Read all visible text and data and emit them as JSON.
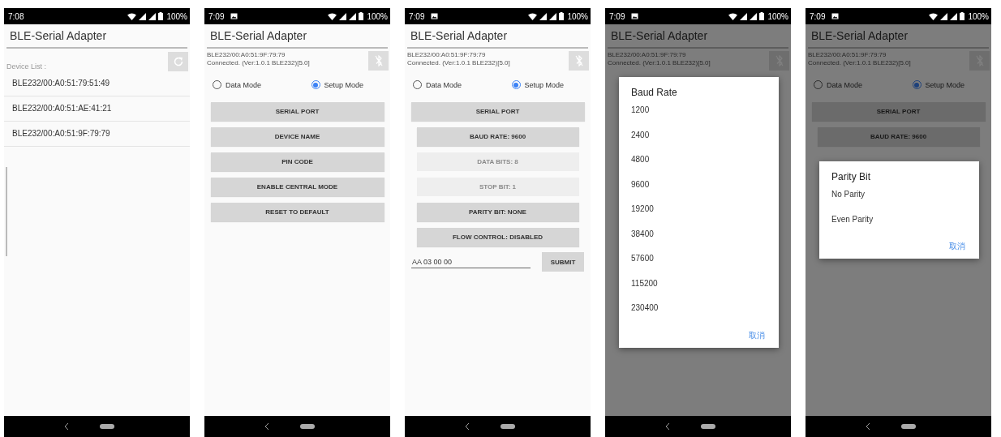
{
  "screens": [
    {
      "kind": "device_list",
      "status_bar": {
        "time": "7:08",
        "notification_icon": false,
        "battery": "100%"
      },
      "title": "BLE-Serial Adapter",
      "list_label": "Device List :",
      "devices": [
        "BLE232/00:A0:51:79:51:49",
        "BLE232/00:A0:51:AE:41:21",
        "BLE232/00:A0:51:9F:79:79"
      ]
    },
    {
      "kind": "setup",
      "status_bar": {
        "time": "7:09",
        "notification_icon": true,
        "battery": "100%"
      },
      "title": "BLE-Serial Adapter",
      "device_info": [
        "BLE232/00:A0:51:9F:79:79",
        "Connected. (Ver:1.0.1 BLE232)[5.0]"
      ],
      "modes": [
        {
          "label": "Data Mode",
          "selected": false
        },
        {
          "label": "Setup Mode",
          "selected": true
        }
      ],
      "buttons": [
        {
          "label": "SERIAL PORT",
          "kind": "main",
          "disabled": false
        },
        {
          "label": "DEVICE NAME",
          "kind": "main",
          "disabled": false
        },
        {
          "label": "PIN CODE",
          "kind": "main",
          "disabled": false
        },
        {
          "label": "ENABLE CENTRAL MODE",
          "kind": "main",
          "disabled": false
        },
        {
          "label": "RESET TO DEFAULT",
          "kind": "main",
          "disabled": false
        }
      ]
    },
    {
      "kind": "setup",
      "status_bar": {
        "time": "7:09",
        "notification_icon": true,
        "battery": "100%"
      },
      "title": "BLE-Serial Adapter",
      "device_info": [
        "BLE232/00:A0:51:9F:79:79",
        "Connected. (Ver:1.0.1 BLE232)[5.0]"
      ],
      "modes": [
        {
          "label": "Data Mode",
          "selected": false
        },
        {
          "label": "Setup Mode",
          "selected": true
        }
      ],
      "buttons": [
        {
          "label": "SERIAL PORT",
          "kind": "main",
          "disabled": false
        },
        {
          "label": "BAUD RATE: 9600",
          "kind": "sub",
          "disabled": false
        },
        {
          "label": "DATA BITS: 8",
          "kind": "sub",
          "disabled": true
        },
        {
          "label": "STOP BIT: 1",
          "kind": "sub",
          "disabled": true
        },
        {
          "label": "PARITY BIT: NONE",
          "kind": "sub",
          "disabled": false
        },
        {
          "label": "FLOW CONTROL: DISABLED",
          "kind": "sub",
          "disabled": false
        }
      ],
      "command": {
        "value": "AA 03 00 00",
        "button": "SUBMIT"
      }
    },
    {
      "kind": "setup",
      "status_bar": {
        "time": "7:09",
        "notification_icon": true,
        "battery": "100%"
      },
      "title": "BLE-Serial Adapter",
      "device_info": [
        "BLE232/00:A0:51:9F:79:79",
        "Connected. (Ver:1.0.1 BLE232)[5.0]"
      ],
      "dialog": {
        "title": "Baud Rate",
        "options": [
          "1200",
          "2400",
          "4800",
          "9600",
          "19200",
          "38400",
          "57600",
          "115200",
          "230400"
        ],
        "cancel": "取消",
        "compact": false
      }
    },
    {
      "kind": "setup",
      "status_bar": {
        "time": "7:09",
        "notification_icon": true,
        "battery": "100%"
      },
      "title": "BLE-Serial Adapter",
      "device_info": [
        "BLE232/00:A0:51:9F:79:79",
        "Connected. (Ver:1.0.1 BLE232)[5.0]"
      ],
      "modes": [
        {
          "label": "Data Mode",
          "selected": false
        },
        {
          "label": "Setup Mode",
          "selected": true
        }
      ],
      "buttons": [
        {
          "label": "SERIAL PORT",
          "kind": "main",
          "disabled": false
        },
        {
          "label": "BAUD RATE: 9600",
          "kind": "sub",
          "disabled": false
        }
      ],
      "dialog": {
        "title": "Parity Bit",
        "options": [
          "No Parity",
          "Even Parity"
        ],
        "cancel": "取消",
        "compact": true
      }
    }
  ]
}
